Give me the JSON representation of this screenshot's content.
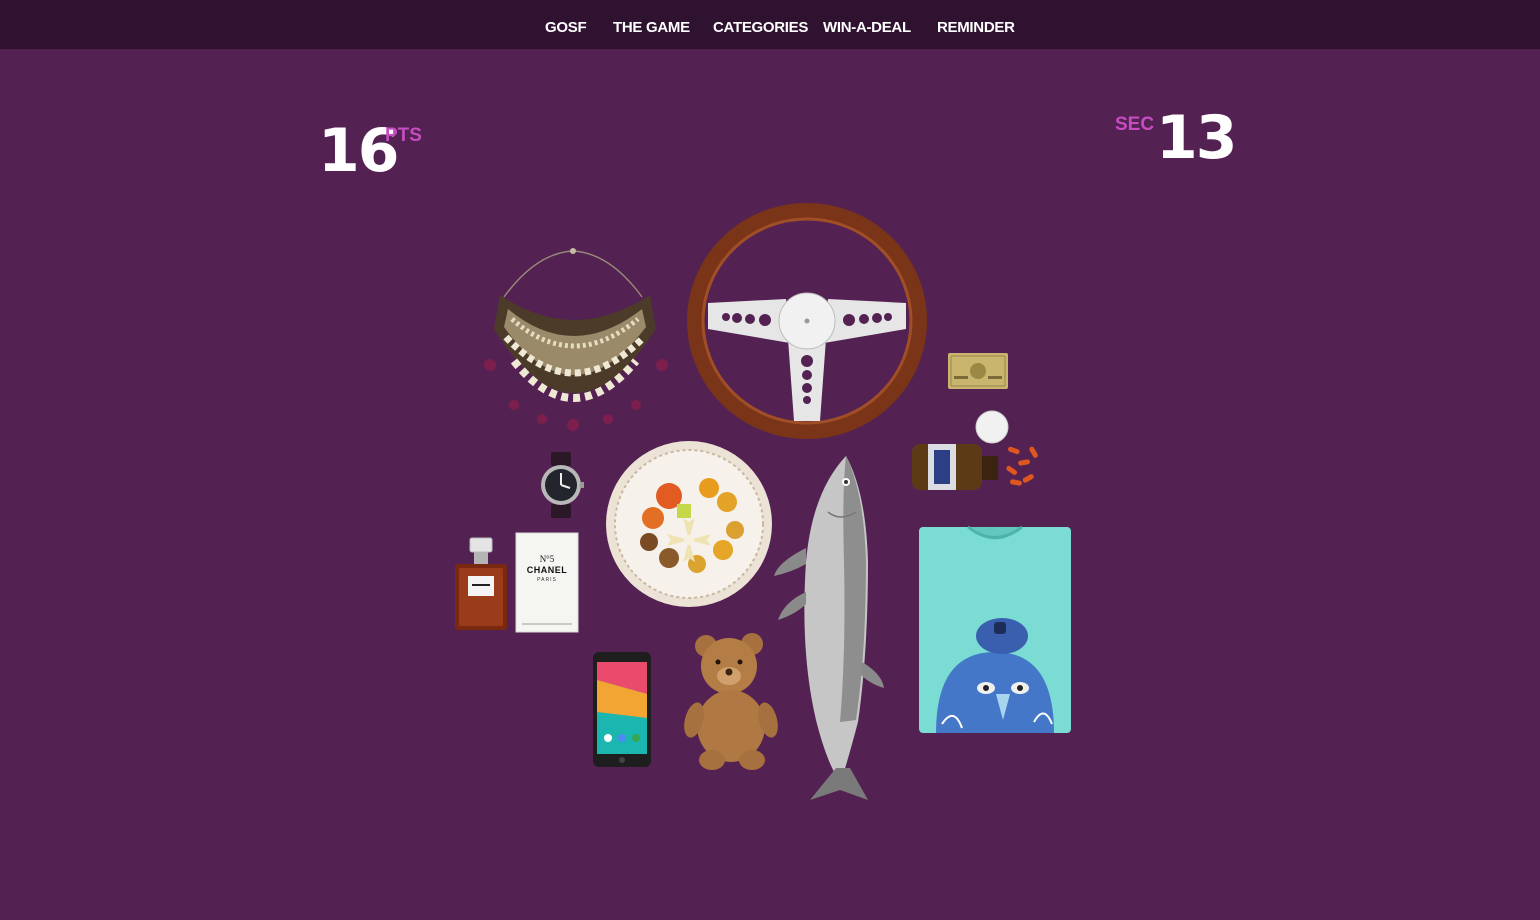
{
  "nav": {
    "items": [
      {
        "label": "GOSF"
      },
      {
        "label": "THE GAME"
      },
      {
        "label": "CATEGORIES"
      },
      {
        "label": "WIN-A-DEAL"
      },
      {
        "label": "REMINDER"
      }
    ]
  },
  "score": {
    "value": "16",
    "unit": "PTS"
  },
  "timer": {
    "unit": "SEC",
    "value": "13"
  },
  "colors": {
    "background": "#532253",
    "nav_bar": "#2f1230",
    "accent": "#c54dc1"
  },
  "game_items": [
    {
      "icon": "necklace-icon"
    },
    {
      "icon": "steering-wheel-icon"
    },
    {
      "icon": "credit-card-icon"
    },
    {
      "icon": "supplement-bottle-icon"
    },
    {
      "icon": "wristwatch-icon"
    },
    {
      "icon": "food-plate-icon"
    },
    {
      "icon": "perfume-bottle-icon"
    },
    {
      "icon": "perfume-box-icon",
      "text": [
        "N°5",
        "CHANEL",
        "PARIS"
      ]
    },
    {
      "icon": "fish-icon"
    },
    {
      "icon": "tshirt-icon"
    },
    {
      "icon": "smartphone-icon"
    },
    {
      "icon": "teddy-bear-icon"
    }
  ]
}
